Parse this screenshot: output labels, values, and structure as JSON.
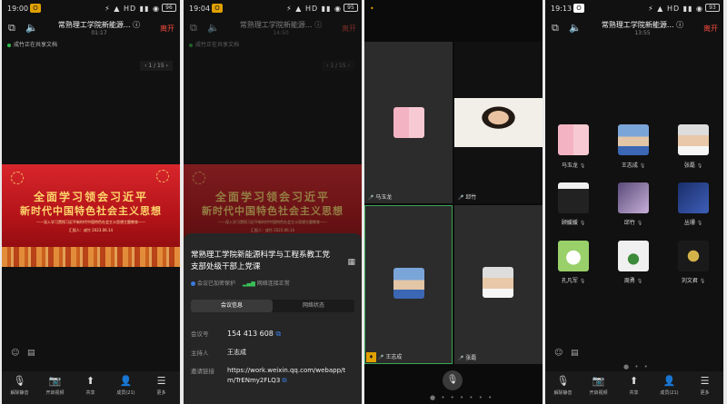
{
  "panels": [
    {
      "status": {
        "time": "19:00",
        "badge": "O",
        "icons": "⚡ ▲ HD ▮▮ ◉",
        "battery": "96"
      },
      "header": {
        "title": "常熟理工学院新能源... ⓘ",
        "subtitle": "01:17",
        "leave": "离开"
      },
      "sharing": "成竹正在共享文档",
      "pager": "‹ 1 / 15 ›",
      "slide": {
        "line1": "全面学习领会习近平",
        "line2": "新时代中国特色社会主义思想",
        "line3": "——深入学习贯彻习近平新时代中国特色社会主义思想主题教育——",
        "line4": "汇报人：成竹    2023.06.14"
      },
      "toolbar": [
        {
          "icon": "mic-off-icon",
          "glyph": "🎙",
          "label": "解除静音"
        },
        {
          "icon": "camera-off-icon",
          "glyph": "📷",
          "label": "开启视频"
        },
        {
          "icon": "share-icon",
          "glyph": "⬆",
          "label": "共享"
        },
        {
          "icon": "members-icon",
          "glyph": "👤",
          "label": "成员(21)"
        },
        {
          "icon": "more-icon",
          "glyph": "☰",
          "label": "更多"
        }
      ]
    },
    {
      "status": {
        "time": "19:04",
        "badge": "O",
        "icons": "⚡ ▲ HD ▮▮ ◉",
        "battery": "95"
      },
      "header": {
        "title": "常熟理工学院新能源... ⓘ",
        "subtitle": "14:50",
        "leave": "离开"
      },
      "sharing": "成竹正在共享文档",
      "pager": "‹ 1 / 15 ›",
      "slide": {
        "line1": "全面学习领会习近平",
        "line2": "新时代中国特色社会主义思想",
        "line3": "——深入学习贯彻习近平新时代中国特色社会主义思想主题教育——",
        "line4": "汇报人：成竹    2023.06.14"
      },
      "sheet": {
        "title": "常熟理工学院新能源科学与工程系教工党支部处级干部上党课",
        "protect": "会议已加密保护",
        "network": "网络连接正常",
        "tab_info": "会议信息",
        "tab_net": "网络状态",
        "id_label": "会议号",
        "id_value": "154 413 608",
        "host_label": "主持人",
        "host_value": "王志成",
        "link_label": "邀请链接",
        "link_value": "https://work.weixin.qq.com/webapp/tm/TrENmy2FLQ3"
      }
    },
    {
      "status": {
        "time": "•"
      },
      "tiles": [
        {
          "name": "马玉龙"
        },
        {
          "name": "邱竹"
        },
        {
          "name": "王志成"
        },
        {
          "name": "张磊"
        }
      ],
      "dots": "● • • • • • •"
    },
    {
      "status": {
        "time": "19:13",
        "badge": "O",
        "icons": "⚡ ▲ HD ▮▮ ◉",
        "battery": "93"
      },
      "header": {
        "title": "常熟理工学院新能源... ⓘ",
        "subtitle": "13:55",
        "leave": "离开"
      },
      "grid": [
        {
          "name": "马玉龙"
        },
        {
          "name": "王志成"
        },
        {
          "name": "张磊"
        },
        {
          "name": "顾媛媛"
        },
        {
          "name": "邱竹"
        },
        {
          "name": "丛珊"
        },
        {
          "name": "孔凡军"
        },
        {
          "name": "周勇"
        },
        {
          "name": "刘文君"
        }
      ],
      "dots": "● • •",
      "toolbar": [
        {
          "icon": "mic-off-icon",
          "glyph": "🎙",
          "label": "解除静音"
        },
        {
          "icon": "camera-off-icon",
          "glyph": "📷",
          "label": "开启视频"
        },
        {
          "icon": "share-icon",
          "glyph": "⬆",
          "label": "共享"
        },
        {
          "icon": "members-icon",
          "glyph": "👤",
          "label": "成员(21)"
        },
        {
          "icon": "more-icon",
          "glyph": "☰",
          "label": "更多"
        }
      ]
    }
  ]
}
